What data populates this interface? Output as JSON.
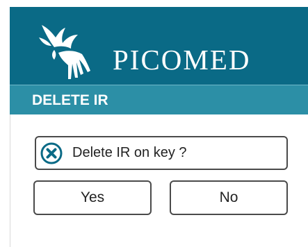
{
  "header": {
    "brand": "PICOMED",
    "logo_icon": "hands-bird-logo-icon",
    "background": "#0a6a86"
  },
  "dialog": {
    "title": "DELETE IR",
    "title_background": "#2c8fa6",
    "message": "Delete IR on key ?",
    "message_icon": "x-circle-icon",
    "yes_label": "Yes",
    "no_label": "No"
  }
}
